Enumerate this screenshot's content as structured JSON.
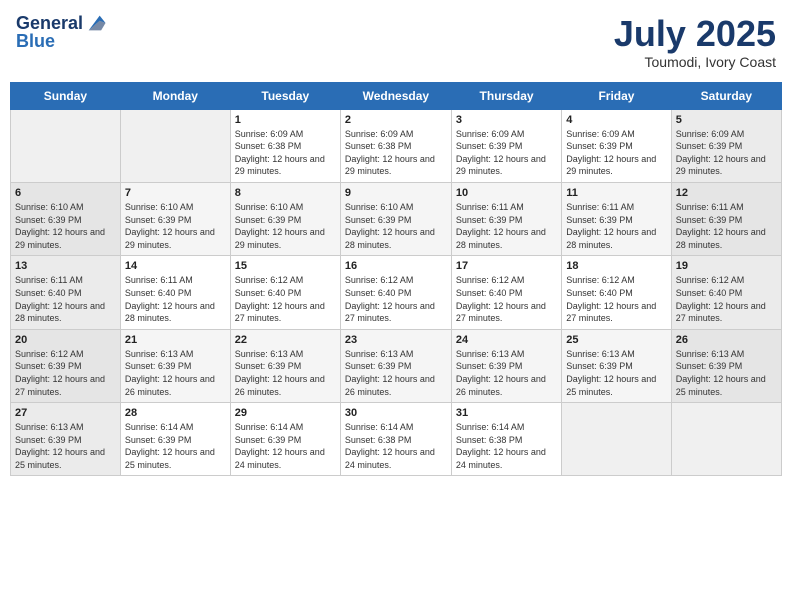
{
  "header": {
    "logo_line1": "General",
    "logo_line2": "Blue",
    "month": "July 2025",
    "location": "Toumodi, Ivory Coast"
  },
  "days_of_week": [
    "Sunday",
    "Monday",
    "Tuesday",
    "Wednesday",
    "Thursday",
    "Friday",
    "Saturday"
  ],
  "weeks": [
    [
      {
        "day": "",
        "sunrise": "",
        "sunset": "",
        "daylight": ""
      },
      {
        "day": "",
        "sunrise": "",
        "sunset": "",
        "daylight": ""
      },
      {
        "day": "1",
        "sunrise": "Sunrise: 6:09 AM",
        "sunset": "Sunset: 6:38 PM",
        "daylight": "Daylight: 12 hours and 29 minutes."
      },
      {
        "day": "2",
        "sunrise": "Sunrise: 6:09 AM",
        "sunset": "Sunset: 6:38 PM",
        "daylight": "Daylight: 12 hours and 29 minutes."
      },
      {
        "day": "3",
        "sunrise": "Sunrise: 6:09 AM",
        "sunset": "Sunset: 6:39 PM",
        "daylight": "Daylight: 12 hours and 29 minutes."
      },
      {
        "day": "4",
        "sunrise": "Sunrise: 6:09 AM",
        "sunset": "Sunset: 6:39 PM",
        "daylight": "Daylight: 12 hours and 29 minutes."
      },
      {
        "day": "5",
        "sunrise": "Sunrise: 6:09 AM",
        "sunset": "Sunset: 6:39 PM",
        "daylight": "Daylight: 12 hours and 29 minutes."
      }
    ],
    [
      {
        "day": "6",
        "sunrise": "Sunrise: 6:10 AM",
        "sunset": "Sunset: 6:39 PM",
        "daylight": "Daylight: 12 hours and 29 minutes."
      },
      {
        "day": "7",
        "sunrise": "Sunrise: 6:10 AM",
        "sunset": "Sunset: 6:39 PM",
        "daylight": "Daylight: 12 hours and 29 minutes."
      },
      {
        "day": "8",
        "sunrise": "Sunrise: 6:10 AM",
        "sunset": "Sunset: 6:39 PM",
        "daylight": "Daylight: 12 hours and 29 minutes."
      },
      {
        "day": "9",
        "sunrise": "Sunrise: 6:10 AM",
        "sunset": "Sunset: 6:39 PM",
        "daylight": "Daylight: 12 hours and 28 minutes."
      },
      {
        "day": "10",
        "sunrise": "Sunrise: 6:11 AM",
        "sunset": "Sunset: 6:39 PM",
        "daylight": "Daylight: 12 hours and 28 minutes."
      },
      {
        "day": "11",
        "sunrise": "Sunrise: 6:11 AM",
        "sunset": "Sunset: 6:39 PM",
        "daylight": "Daylight: 12 hours and 28 minutes."
      },
      {
        "day": "12",
        "sunrise": "Sunrise: 6:11 AM",
        "sunset": "Sunset: 6:39 PM",
        "daylight": "Daylight: 12 hours and 28 minutes."
      }
    ],
    [
      {
        "day": "13",
        "sunrise": "Sunrise: 6:11 AM",
        "sunset": "Sunset: 6:40 PM",
        "daylight": "Daylight: 12 hours and 28 minutes."
      },
      {
        "day": "14",
        "sunrise": "Sunrise: 6:11 AM",
        "sunset": "Sunset: 6:40 PM",
        "daylight": "Daylight: 12 hours and 28 minutes."
      },
      {
        "day": "15",
        "sunrise": "Sunrise: 6:12 AM",
        "sunset": "Sunset: 6:40 PM",
        "daylight": "Daylight: 12 hours and 27 minutes."
      },
      {
        "day": "16",
        "sunrise": "Sunrise: 6:12 AM",
        "sunset": "Sunset: 6:40 PM",
        "daylight": "Daylight: 12 hours and 27 minutes."
      },
      {
        "day": "17",
        "sunrise": "Sunrise: 6:12 AM",
        "sunset": "Sunset: 6:40 PM",
        "daylight": "Daylight: 12 hours and 27 minutes."
      },
      {
        "day": "18",
        "sunrise": "Sunrise: 6:12 AM",
        "sunset": "Sunset: 6:40 PM",
        "daylight": "Daylight: 12 hours and 27 minutes."
      },
      {
        "day": "19",
        "sunrise": "Sunrise: 6:12 AM",
        "sunset": "Sunset: 6:40 PM",
        "daylight": "Daylight: 12 hours and 27 minutes."
      }
    ],
    [
      {
        "day": "20",
        "sunrise": "Sunrise: 6:12 AM",
        "sunset": "Sunset: 6:39 PM",
        "daylight": "Daylight: 12 hours and 27 minutes."
      },
      {
        "day": "21",
        "sunrise": "Sunrise: 6:13 AM",
        "sunset": "Sunset: 6:39 PM",
        "daylight": "Daylight: 12 hours and 26 minutes."
      },
      {
        "day": "22",
        "sunrise": "Sunrise: 6:13 AM",
        "sunset": "Sunset: 6:39 PM",
        "daylight": "Daylight: 12 hours and 26 minutes."
      },
      {
        "day": "23",
        "sunrise": "Sunrise: 6:13 AM",
        "sunset": "Sunset: 6:39 PM",
        "daylight": "Daylight: 12 hours and 26 minutes."
      },
      {
        "day": "24",
        "sunrise": "Sunrise: 6:13 AM",
        "sunset": "Sunset: 6:39 PM",
        "daylight": "Daylight: 12 hours and 26 minutes."
      },
      {
        "day": "25",
        "sunrise": "Sunrise: 6:13 AM",
        "sunset": "Sunset: 6:39 PM",
        "daylight": "Daylight: 12 hours and 25 minutes."
      },
      {
        "day": "26",
        "sunrise": "Sunrise: 6:13 AM",
        "sunset": "Sunset: 6:39 PM",
        "daylight": "Daylight: 12 hours and 25 minutes."
      }
    ],
    [
      {
        "day": "27",
        "sunrise": "Sunrise: 6:13 AM",
        "sunset": "Sunset: 6:39 PM",
        "daylight": "Daylight: 12 hours and 25 minutes."
      },
      {
        "day": "28",
        "sunrise": "Sunrise: 6:14 AM",
        "sunset": "Sunset: 6:39 PM",
        "daylight": "Daylight: 12 hours and 25 minutes."
      },
      {
        "day": "29",
        "sunrise": "Sunrise: 6:14 AM",
        "sunset": "Sunset: 6:39 PM",
        "daylight": "Daylight: 12 hours and 24 minutes."
      },
      {
        "day": "30",
        "sunrise": "Sunrise: 6:14 AM",
        "sunset": "Sunset: 6:38 PM",
        "daylight": "Daylight: 12 hours and 24 minutes."
      },
      {
        "day": "31",
        "sunrise": "Sunrise: 6:14 AM",
        "sunset": "Sunset: 6:38 PM",
        "daylight": "Daylight: 12 hours and 24 minutes."
      },
      {
        "day": "",
        "sunrise": "",
        "sunset": "",
        "daylight": ""
      },
      {
        "day": "",
        "sunrise": "",
        "sunset": "",
        "daylight": ""
      }
    ]
  ]
}
